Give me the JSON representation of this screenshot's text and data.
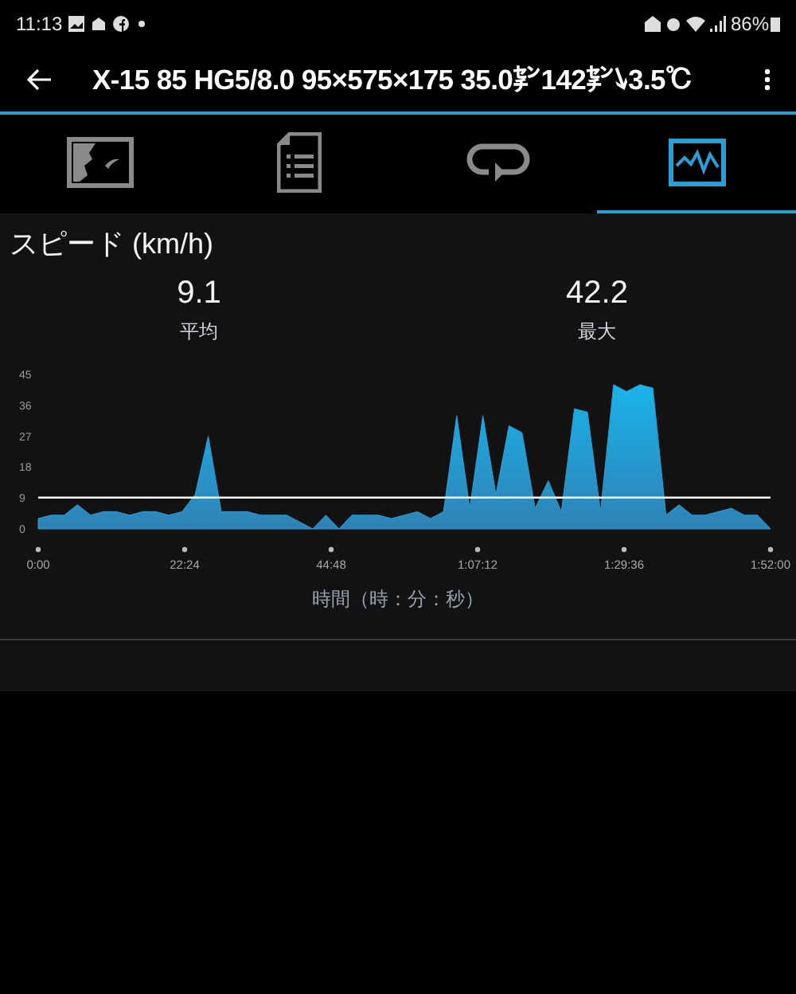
{
  "status_bar": {
    "time": "11:13",
    "battery": "86%"
  },
  "app_bar": {
    "title": "X-15 85 HG5/8.0 95×575×175 35.0㌢142㌢↘3.5℃"
  },
  "tabs": [
    {
      "kind": "map",
      "selected": false
    },
    {
      "kind": "details",
      "selected": false
    },
    {
      "kind": "laps",
      "selected": false
    },
    {
      "kind": "graph",
      "selected": true
    }
  ],
  "section": {
    "title": "スピード (km/h)",
    "stats": [
      {
        "value": "9.1",
        "label": "平均"
      },
      {
        "value": "42.2",
        "label": "最大"
      }
    ],
    "chart_data": {
      "type": "area",
      "xlabel": "時間（時：分：秒）",
      "x": [
        0,
        2,
        4,
        6,
        8,
        10,
        12,
        14,
        16,
        18,
        20,
        22,
        24,
        26,
        28,
        30,
        32,
        34,
        36,
        38,
        40,
        42,
        44,
        46,
        48,
        50,
        52,
        54,
        56,
        58,
        60,
        62,
        64,
        66,
        68,
        70,
        72,
        74,
        76,
        78,
        80,
        82,
        84,
        86,
        88,
        90,
        92,
        94,
        96,
        98,
        100,
        102,
        104,
        106,
        108,
        110,
        112
      ],
      "series": [
        {
          "color": "#2a9fd6",
          "values": [
            3,
            4,
            4,
            7,
            4,
            5,
            5,
            4,
            5,
            5,
            4,
            5,
            10,
            27,
            5,
            5,
            5,
            4,
            4,
            4,
            2,
            0,
            4,
            0,
            4,
            4,
            4,
            3,
            4,
            5,
            3,
            5,
            33,
            6,
            33,
            10,
            30,
            28,
            6,
            14,
            5,
            35,
            34,
            5,
            42,
            40,
            42,
            41,
            4,
            7,
            4,
            4,
            5,
            6,
            4,
            4,
            0
          ]
        }
      ],
      "xlim": [
        0,
        112
      ],
      "ylim": [
        0,
        45
      ],
      "xticks": [
        {
          "value": 0,
          "label": "0:00"
        },
        {
          "value": 22.4,
          "label": "22:24"
        },
        {
          "value": 44.8,
          "label": "44:48"
        },
        {
          "value": 67.2,
          "label": "1:07:12"
        },
        {
          "value": 89.6,
          "label": "1:29:36"
        },
        {
          "value": 112,
          "label": "1:52:00"
        }
      ],
      "yticks": [
        0,
        9,
        18,
        27,
        36,
        45
      ]
    }
  }
}
